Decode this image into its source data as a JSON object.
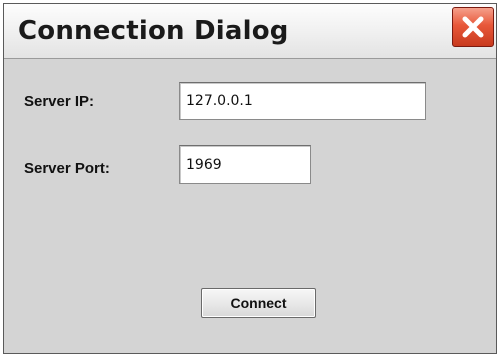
{
  "window": {
    "title": "Connection Dialog"
  },
  "form": {
    "server_ip": {
      "label": "Server IP:",
      "value": "127.0.0.1"
    },
    "server_port": {
      "label": "Server Port:",
      "value": "1969"
    }
  },
  "actions": {
    "connect_label": "Connect"
  },
  "icons": {
    "close": "close-icon"
  },
  "colors": {
    "dialog_background": "#d4d4d4",
    "close_button": "#e8583a",
    "title_text": "#1a1a1a"
  }
}
